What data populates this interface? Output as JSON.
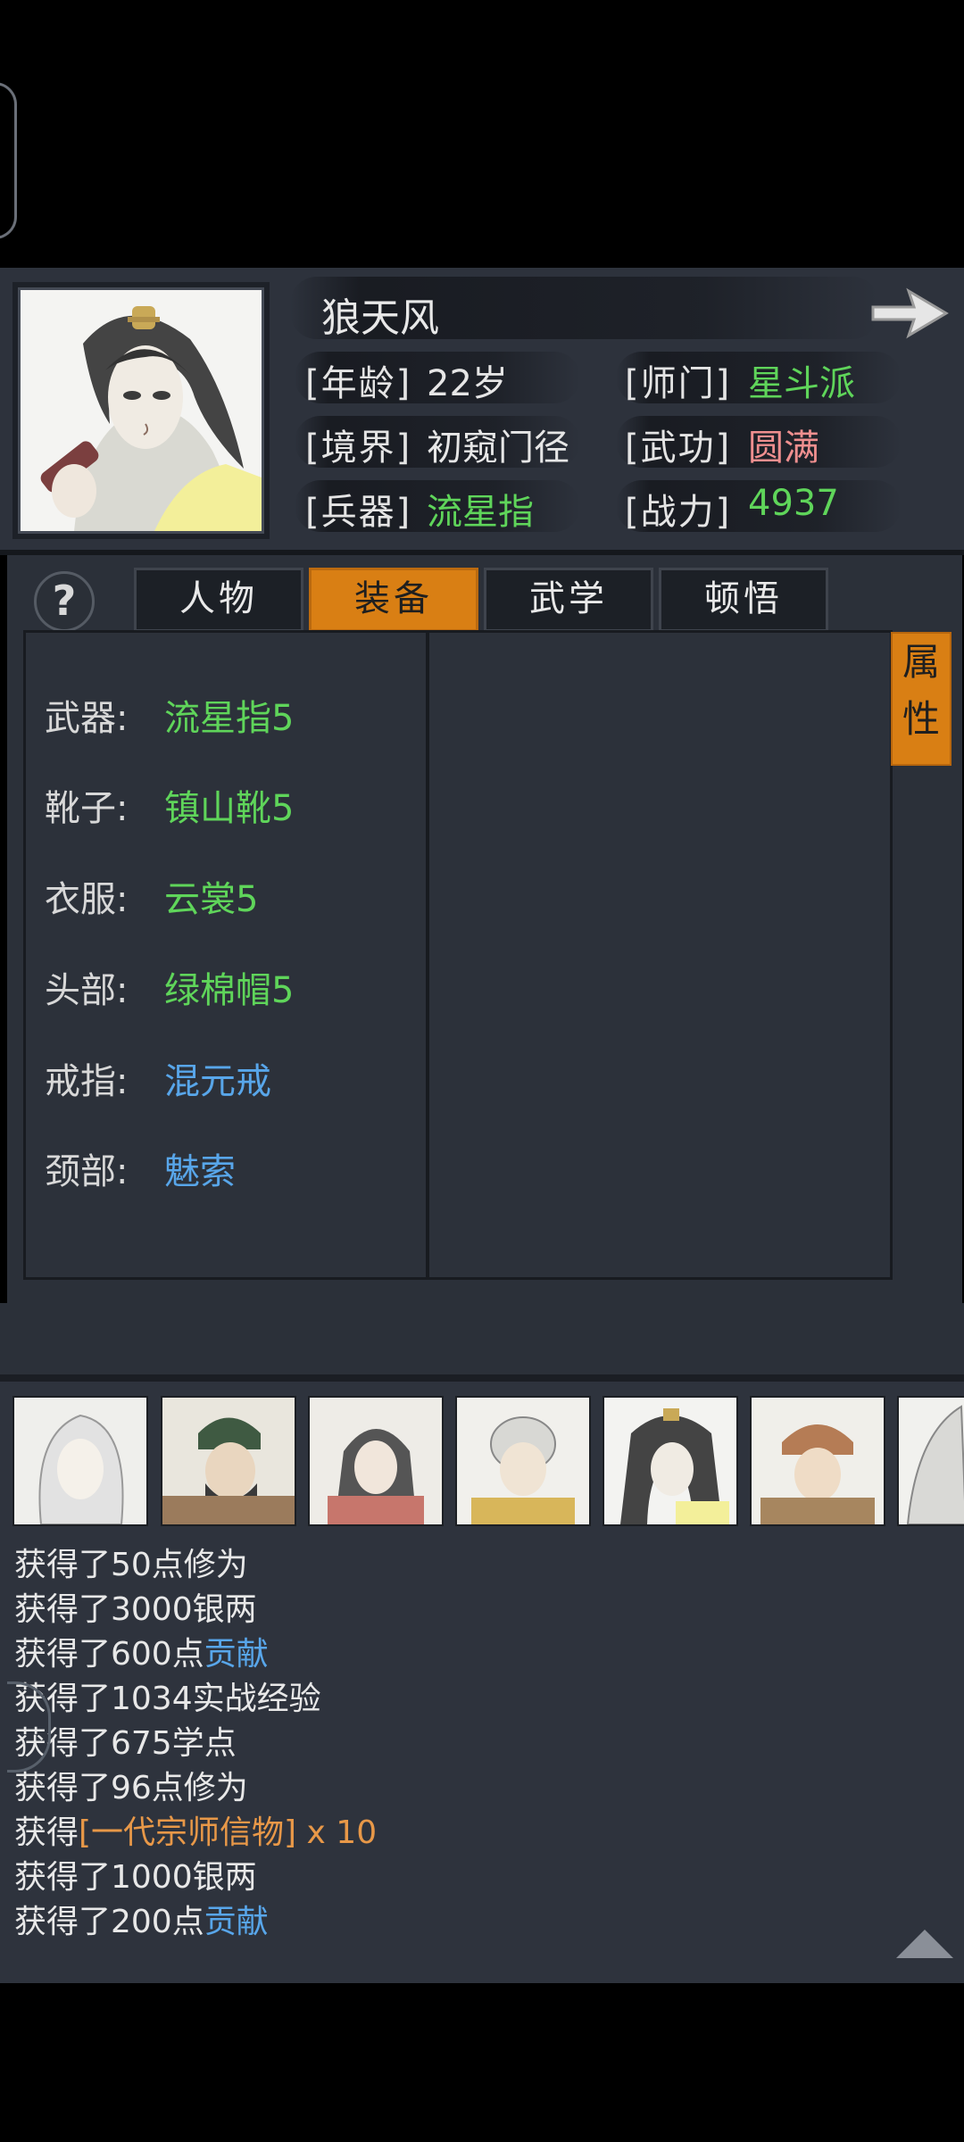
{
  "profile": {
    "name": "狼天风",
    "stats": [
      {
        "label": "[年龄]",
        "value": "22岁",
        "color": "#e6e6e6"
      },
      {
        "label": "[师门]",
        "value": "星斗派",
        "color": "#5fd55a"
      },
      {
        "label": "[境界]",
        "value": "初窥门径",
        "color": "#e6e6e6"
      },
      {
        "label": "[武功]",
        "value": "圆满",
        "color": "#ef8f8f"
      },
      {
        "label": "[兵器]",
        "value": "流星指",
        "color": "#5fd55a"
      },
      {
        "label": "[战力]",
        "value": "4937",
        "color": "#5fd55a"
      }
    ]
  },
  "help_label": "?",
  "tabs": [
    {
      "label": "人物",
      "active": false
    },
    {
      "label": "装备",
      "active": true
    },
    {
      "label": "武学",
      "active": false
    },
    {
      "label": "顿悟",
      "active": false
    }
  ],
  "attr_tab": {
    "line1": "属",
    "line2": "性"
  },
  "equipment": [
    {
      "slot": "武器:",
      "item": "流星指5",
      "color": "#5fd55a"
    },
    {
      "slot": "靴子:",
      "item": "镇山靴5",
      "color": "#5fd55a"
    },
    {
      "slot": "衣服:",
      "item": "云裳5",
      "color": "#5fd55a"
    },
    {
      "slot": "头部:",
      "item": "绿棉帽5",
      "color": "#5fd55a"
    },
    {
      "slot": "戒指:",
      "item": "混元戒",
      "color": "#58a6ea"
    },
    {
      "slot": "颈部:",
      "item": "魅索",
      "color": "#58a6ea"
    }
  ],
  "log": [
    {
      "prefix": "获得了50点修为",
      "highlight": ""
    },
    {
      "prefix": "获得了3000银两",
      "highlight": ""
    },
    {
      "prefix": "获得了600点",
      "highlight": "贡献"
    },
    {
      "prefix": "获得了1034实战经验",
      "highlight": ""
    },
    {
      "prefix": "获得了675学点",
      "highlight": ""
    },
    {
      "prefix": "获得了96点修为",
      "highlight": ""
    },
    {
      "prefix": "获得",
      "highlight": "[一代宗师信物] x 10"
    },
    {
      "prefix": "获得了1000银两",
      "highlight": ""
    },
    {
      "prefix": "获得了200点",
      "highlight": "贡献"
    }
  ]
}
